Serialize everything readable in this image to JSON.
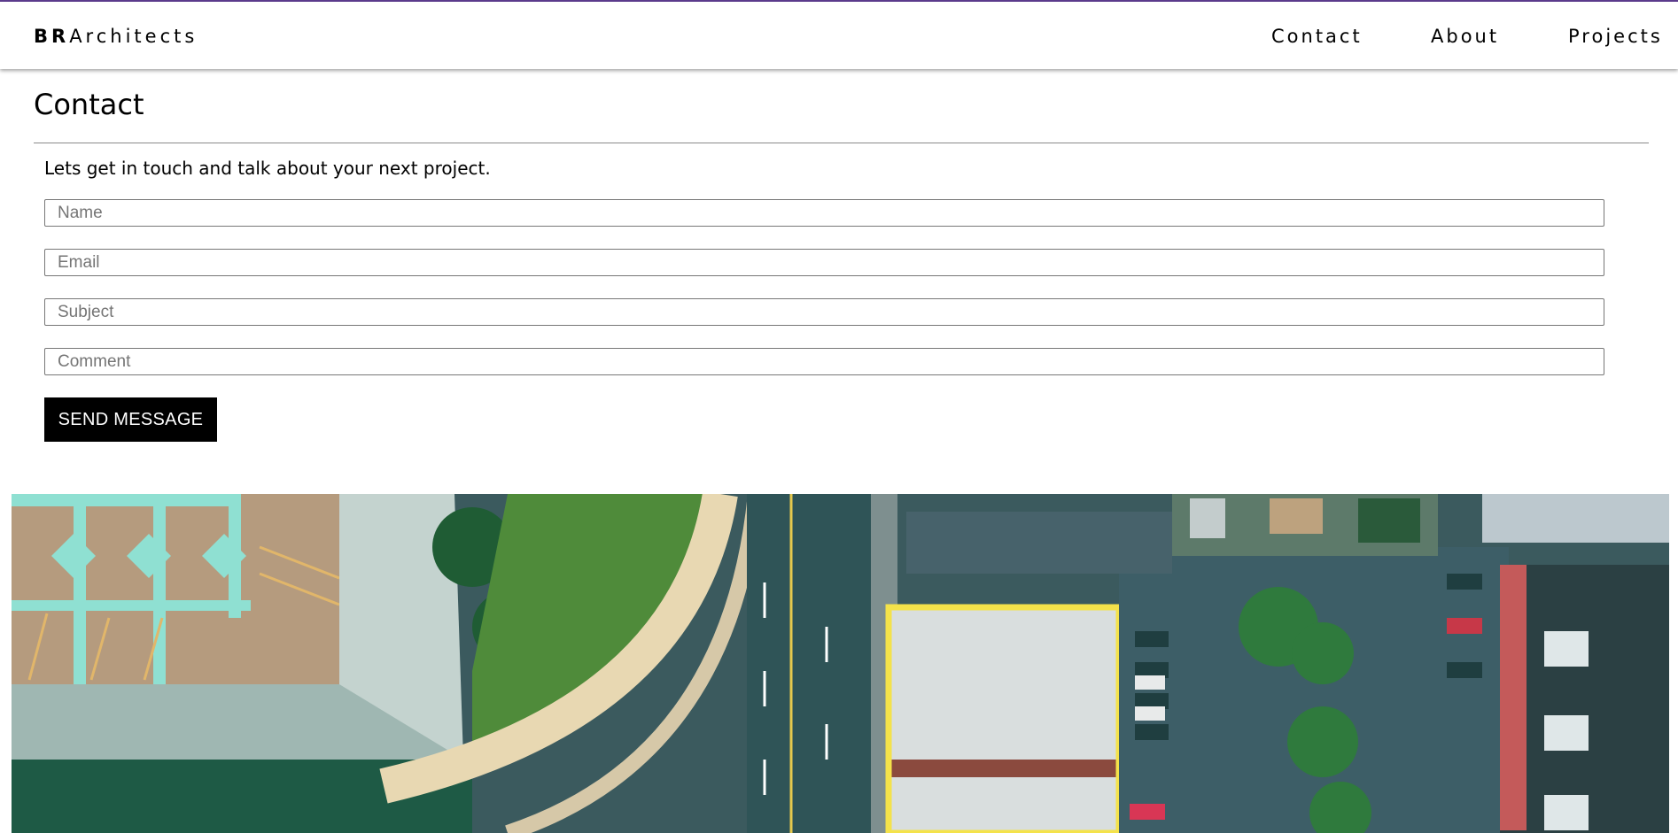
{
  "header": {
    "brand_bold": "BR",
    "brand_rest": "Architects",
    "nav": [
      {
        "label": "Contact"
      },
      {
        "label": "About"
      },
      {
        "label": "Projects"
      }
    ],
    "accent_color": "#5b3b8c"
  },
  "contact": {
    "title": "Contact",
    "intro": "Lets get in touch and talk about your next project.",
    "fields": {
      "name_placeholder": "Name",
      "email_placeholder": "Email",
      "subject_placeholder": "Subject",
      "comment_placeholder": "Comment"
    },
    "submit_label": "SEND MESSAGE"
  },
  "hero": {
    "description_icon": "aerial-city-photo",
    "highlight_color": "#f4e24a"
  }
}
